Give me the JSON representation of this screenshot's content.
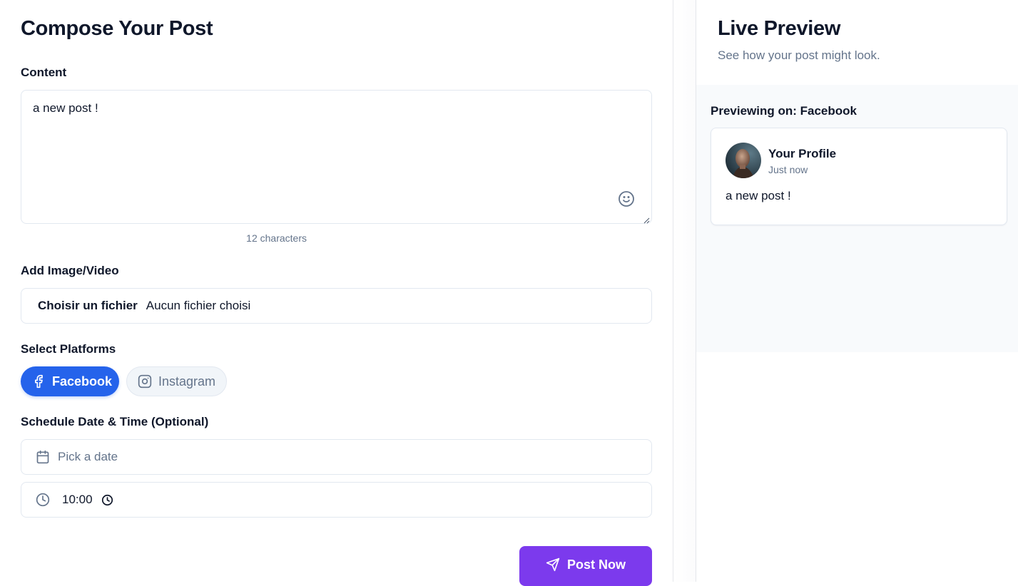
{
  "composer": {
    "title": "Compose Your Post",
    "content_label": "Content",
    "content_value": "a new post !",
    "char_count": "12 characters",
    "media_label": "Add Image/Video",
    "file_button": "Choisir un fichier",
    "file_status": "Aucun fichier choisi",
    "platforms_label": "Select Platforms",
    "platforms": [
      {
        "label": "Facebook",
        "icon": "facebook-icon",
        "selected": true
      },
      {
        "label": "Instagram",
        "icon": "instagram-icon",
        "selected": false
      }
    ],
    "schedule_label": "Schedule Date & Time (Optional)",
    "date_placeholder": "Pick a date",
    "time_value": "10:00",
    "post_button": "Post Now"
  },
  "preview": {
    "title": "Live Preview",
    "subtitle": "See how your post might look.",
    "previewing_on": "Previewing on: Facebook",
    "profile_name": "Your Profile",
    "post_time": "Just now",
    "post_text": "a new post !"
  },
  "colors": {
    "facebook_selected": "#2563eb",
    "post_button": "#7c3aed",
    "muted_text": "#64748b",
    "border": "#e2e8f0"
  }
}
